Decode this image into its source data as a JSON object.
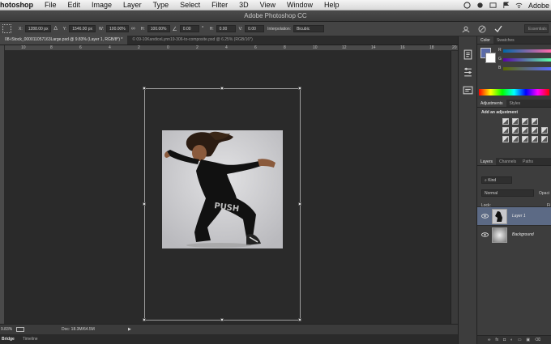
{
  "menubar": {
    "app_name": "hotoshop",
    "items": [
      "File",
      "Edit",
      "Image",
      "Layer",
      "Type",
      "Select",
      "Filter",
      "3D",
      "View",
      "Window",
      "Help"
    ],
    "right_label": "Adobe"
  },
  "window": {
    "title": "Adobe Photoshop CC"
  },
  "options": {
    "x_label": "X:",
    "x_value": "1288.00 px",
    "y_label": "Y:",
    "y_value": "1546.00 px",
    "w_label": "W:",
    "w_value": "100.00%",
    "h_label": "H:",
    "h_value": "100.00%",
    "angle_value": "0.00",
    "angle_unit": "°",
    "hskew_label": "H:",
    "hskew_value": "0.00",
    "vskew_label": "V:",
    "vskew_value": "0.00",
    "interp_label": "Interpolation:",
    "interp_value": "Bicubic",
    "workspace": "Essentials"
  },
  "tabs": [
    {
      "label": "08-iStock_000011057163Large.psd @ 9.83% (Layer 1, RGB/8*) *",
      "active": true
    },
    {
      "label": "© 09-10KandiceLynn19-306-to-composite.psd @ 6.25% (RGB/16*)",
      "active": false
    }
  ],
  "ruler_ticks": [
    "10",
    "8",
    "6",
    "4",
    "2",
    "0",
    "2",
    "4",
    "6",
    "8",
    "10",
    "12",
    "14",
    "16",
    "18",
    "20"
  ],
  "status": {
    "zoom": "9.83%",
    "doc": "Doc: 18.3M/64.5M"
  },
  "bottom_tabs": {
    "bridge": "Bridge",
    "timeline": "Timeline"
  },
  "panels": {
    "color_tabs": [
      "Color",
      "Swatches"
    ],
    "color_sliders": [
      "R",
      "G",
      "B"
    ],
    "adj_tabs": [
      "Adjustments",
      "Styles"
    ],
    "adj_heading": "Add an adjustment",
    "layer_tabs": [
      "Layers",
      "Channels",
      "Paths"
    ],
    "filter_label": "Kind",
    "blend_mode": "Normal",
    "opacity_label": "Opaci",
    "lock_label": "Lock:",
    "fill_label": "Fi",
    "layers": [
      {
        "name": "Layer 1",
        "selected": true
      },
      {
        "name": "Background",
        "selected": false
      }
    ],
    "footer_labels": [
      "fx"
    ]
  },
  "colors": {
    "foreground": "#5a6aa8",
    "selection": "#5c6a85"
  }
}
